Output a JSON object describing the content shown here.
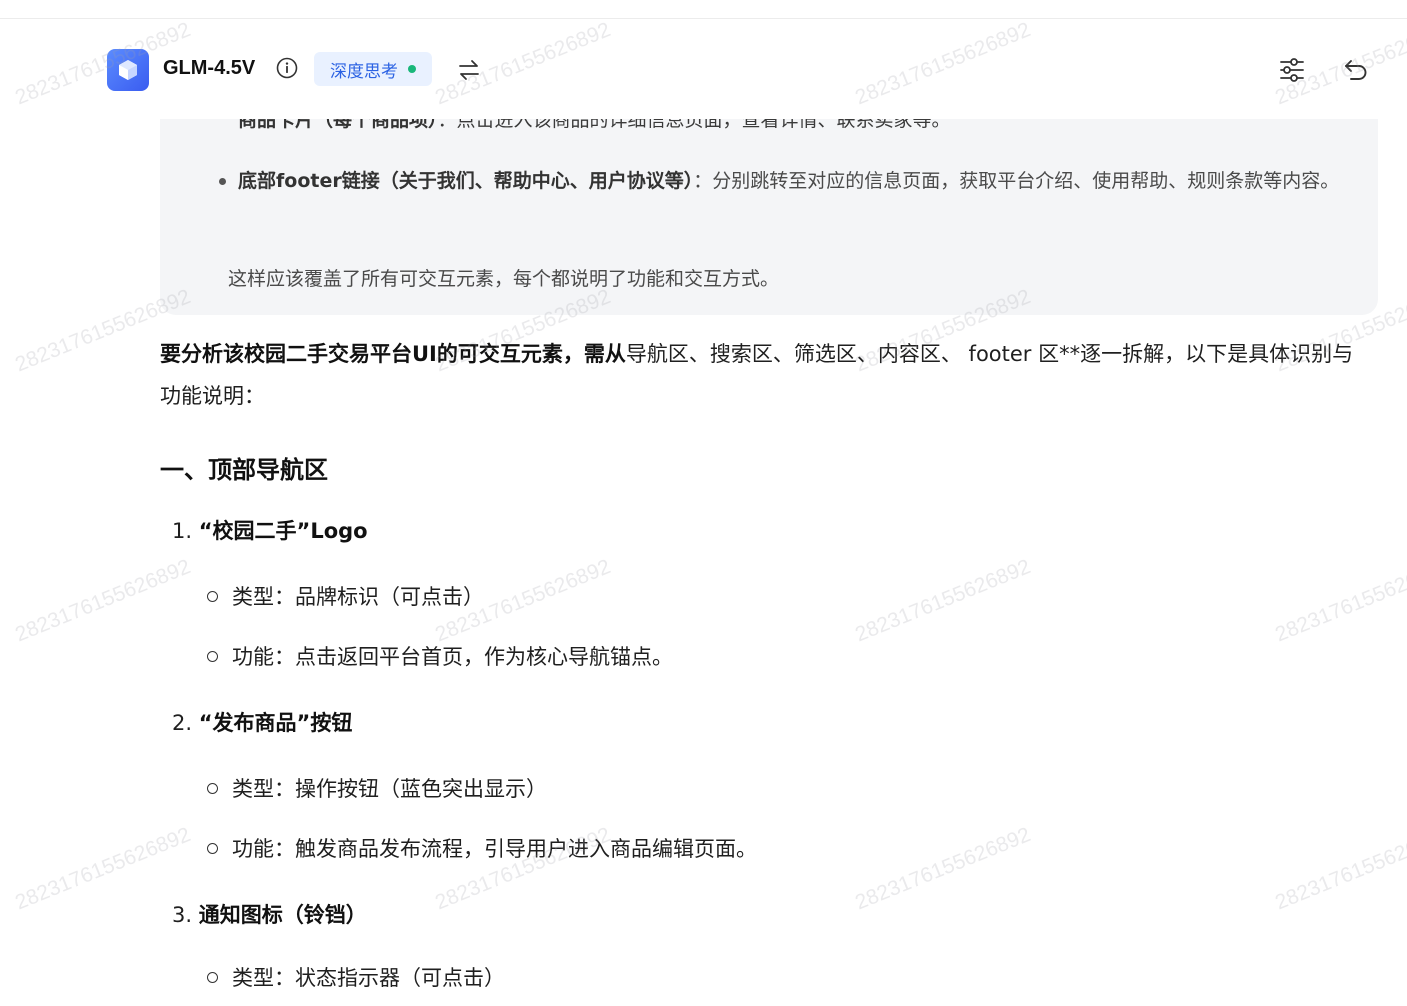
{
  "header": {
    "model_name": "GLM-4.5V",
    "think_badge": "深度思考",
    "accent_color": "#2b62e3",
    "status_dot_color": "#19b77a",
    "icons": [
      "model-cube-icon",
      "info-icon",
      "swap-arrows-icon",
      "settings-sliders-icon",
      "undo-icon"
    ]
  },
  "thinking": {
    "partial_bullet": {
      "bold": "商品卡片（每个商品项）",
      "text": "：点击进入该商品的详细信息页面，查看详情、联系卖家等。"
    },
    "bullet": {
      "bold": "底部footer链接（关于我们、帮助中心、用户协议等）",
      "text": "：分别跳转至对应的信息页面，获取平台介绍、使用帮助、规则条款等内容。"
    },
    "summary": "这样应该覆盖了所有可交互元素，每个都说明了功能和交互方式。"
  },
  "answer": {
    "intro_bold": "要分析该校园二手交易平台UI的可交互元素，需从",
    "intro_rest": "导航区、搜索区、筛选区、内容区、 footer 区**逐一拆解，以下是具体识别与功能说明：",
    "section_title": "一、顶部导航区",
    "items": [
      {
        "number": "1.",
        "title": "“校园二手”Logo",
        "subs": [
          "类型：品牌标识（可点击）",
          "功能：点击返回平台首页，作为核心导航锚点。"
        ]
      },
      {
        "number": "2.",
        "title_bold": "“发布商品”按钮",
        "subs": [
          "类型：操作按钮（蓝色突出显示）",
          "功能：触发商品发布流程，引导用户进入商品编辑页面。"
        ]
      },
      {
        "number": "3.",
        "title_bold": "通知图标（铃铛）",
        "subs": [
          "类型：状态指示器（可点击）"
        ]
      }
    ]
  },
  "watermark": "2823176155626892"
}
